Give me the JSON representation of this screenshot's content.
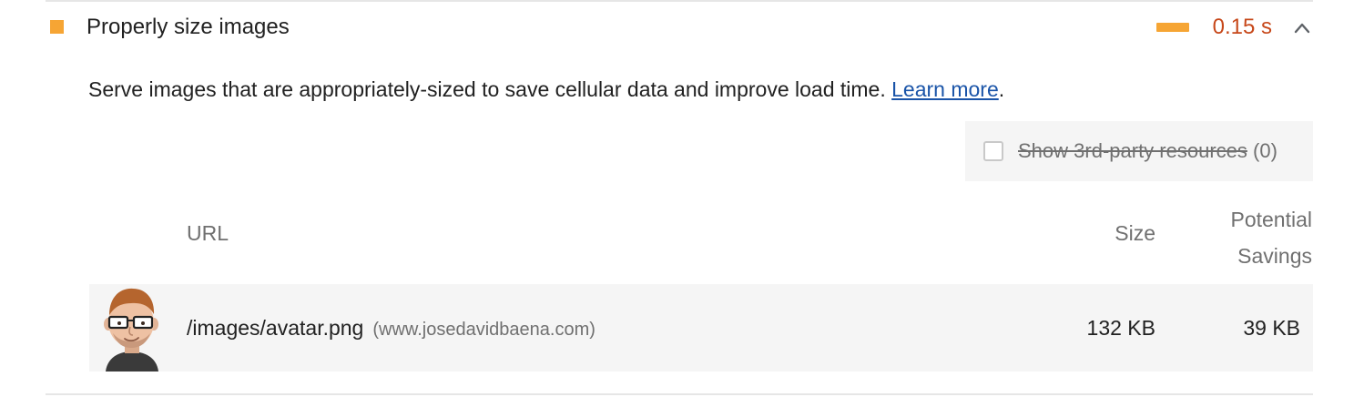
{
  "audit": {
    "title": "Properly size images",
    "savings_display": "0.15 s",
    "status_color": "#f6a534",
    "savings_color": "#c7481a",
    "expand_icon": "chevron-up-icon",
    "description": "Serve images that are appropriately-sized to save cellular data and improve load time.",
    "learn_more_label": "Learn more",
    "description_suffix": "."
  },
  "filter": {
    "label": "Show 3rd-party resources",
    "count": "(0)",
    "checked": false
  },
  "table": {
    "headers": {
      "url": "URL",
      "size": "Size",
      "savings_line1": "Potential",
      "savings_line2": "Savings"
    },
    "rows": [
      {
        "thumbnail": "avatar-thumbnail",
        "url": "/images/avatar.png",
        "host": "(www.josedavidbaena.com)",
        "size": "132 KB",
        "savings": "39 KB"
      }
    ]
  }
}
